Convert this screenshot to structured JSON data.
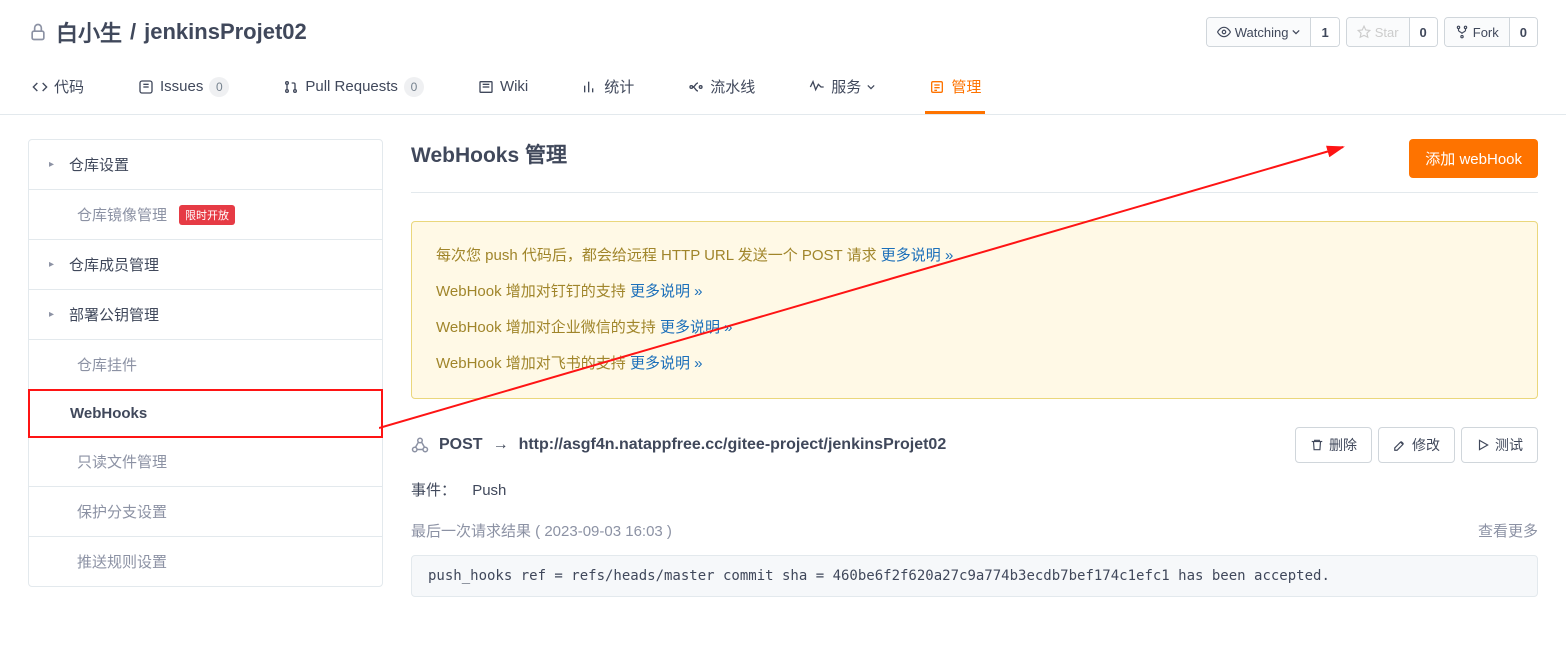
{
  "repo": {
    "owner": "白小生",
    "separator": "/",
    "name": "jenkinsProjet02"
  },
  "actions": {
    "watch_label": "Watching",
    "watch_count": "1",
    "star_label": "Star",
    "star_count": "0",
    "fork_label": "Fork",
    "fork_count": "0"
  },
  "tabs": {
    "code": "代码",
    "issues": "Issues",
    "issues_count": "0",
    "prs": "Pull Requests",
    "prs_count": "0",
    "wiki": "Wiki",
    "stats": "统计",
    "pipeline": "流水线",
    "services": "服务",
    "manage": "管理"
  },
  "sidebar": {
    "repo_settings": "仓库设置",
    "mirror": "仓库镜像管理",
    "mirror_badge": "限时开放",
    "members": "仓库成员管理",
    "deploy_keys": "部署公钥管理",
    "addons": "仓库挂件",
    "webhooks": "WebHooks",
    "readonly": "只读文件管理",
    "protect": "保护分支设置",
    "push_rules": "推送规则设置"
  },
  "content": {
    "title": "WebHooks 管理",
    "add_btn": "添加 webHook"
  },
  "notice": {
    "line1_prefix": "每次您 push 代码后，都会给远程 HTTP URL 发送一个 POST 请求 ",
    "line1_link": "更多说明 »",
    "line2_prefix": "WebHook 增加对钉钉的支持 ",
    "line2_link": "更多说明 »",
    "line3_prefix": "WebHook 增加对企业微信的支持 ",
    "line3_link": "更多说明 »",
    "line4_prefix": "WebHook 增加对飞书的支持 ",
    "line4_link": "更多说明 »"
  },
  "hook": {
    "method": "POST",
    "arrow": "→",
    "url": "http://asgf4n.natappfree.cc/gitee-project/jenkinsProjet02",
    "delete_btn": "删除",
    "edit_btn": "修改",
    "test_btn": "测试",
    "event_label": "事件：",
    "event_value": "Push",
    "result_label": "最后一次请求结果 ( 2023-09-03 16:03 )",
    "more_link": "查看更多",
    "result_code": "push_hooks ref = refs/heads/master commit sha = 460be6f2f620a27c9a774b3ecdb7bef174c1efc1 has been accepted."
  }
}
